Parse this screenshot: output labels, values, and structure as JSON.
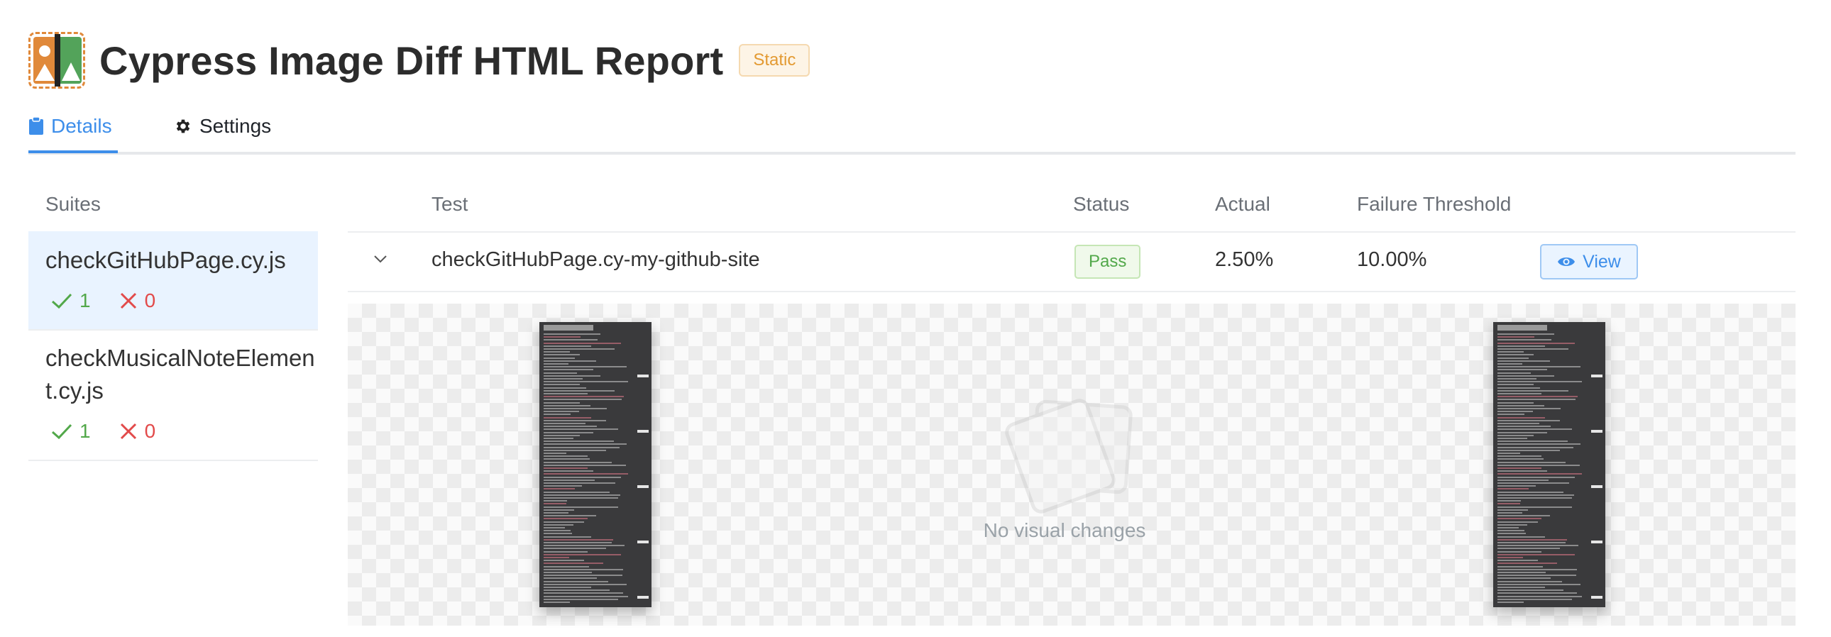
{
  "header": {
    "title": "Cypress Image Diff HTML Report",
    "badge": "Static",
    "logo_icon": "image-diff-logo-icon"
  },
  "tabs": [
    {
      "label": "Details",
      "icon": "clipboard-icon",
      "active": true
    },
    {
      "label": "Settings",
      "icon": "gear-icon",
      "active": false
    }
  ],
  "suites": {
    "heading": "Suites",
    "items": [
      {
        "name": "checkGitHubPage.cy.js",
        "passed": "1",
        "failed": "0",
        "active": true
      },
      {
        "name": "checkMusicalNoteElement.cy.js",
        "passed": "1",
        "failed": "0",
        "active": false
      }
    ]
  },
  "table": {
    "columns": [
      "Test",
      "Status",
      "Actual",
      "Failure Threshold"
    ],
    "rows": [
      {
        "test": "checkGitHubPage.cy-my-github-site",
        "status": "Pass",
        "actual": "2.50%",
        "threshold": "10.00%",
        "action": "View"
      }
    ]
  },
  "preview": {
    "message": "No visual changes",
    "screenshot_header": "READY TO TEST"
  },
  "colors": {
    "accent": "#3d8eea",
    "pass": "#52a84a",
    "fail": "#e24a4a",
    "badge": "#e39a32"
  }
}
